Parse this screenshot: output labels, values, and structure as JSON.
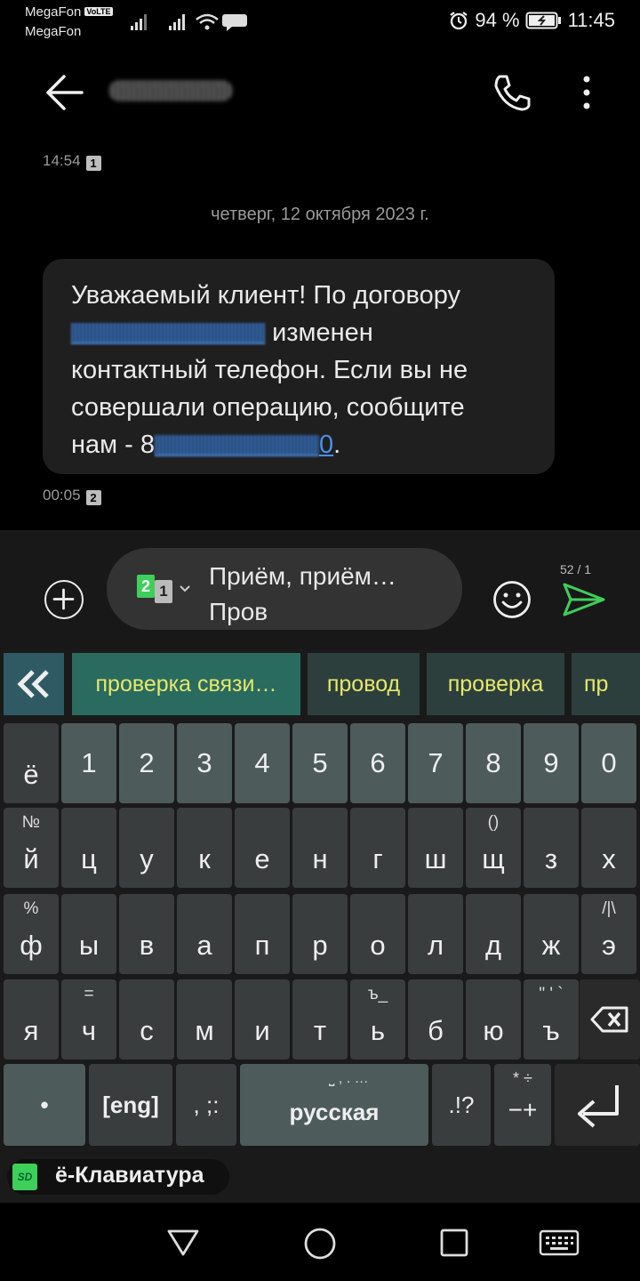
{
  "status_bar": {
    "carrier1": "MegaFon",
    "volte": "VoLTE",
    "carrier2": "MegaFon",
    "battery": "94 %",
    "time": "11:45"
  },
  "header": {
    "contact": ""
  },
  "thread": {
    "prev_time": "14:54",
    "prev_sim": "1",
    "date_divider": "четверг, 12 октября 2023 г.",
    "message": {
      "line1": "Уважаемый клиент! По договору",
      "line2_suffix": "изменен",
      "line3": "контактный телефон. Если вы не",
      "line4": "совершали операцию, сообщите",
      "line5_prefix": "нам - 8",
      "line5_link_end": "0",
      "line5_end": "."
    },
    "time": "00:05",
    "sim": "2"
  },
  "compose": {
    "sim_main": "2",
    "sim_sub": "1",
    "text_line1": "Приём, приём…",
    "text_line2": "Пров",
    "counter": "52 / 1"
  },
  "keyboard": {
    "suggestions": [
      "проверка связи…",
      "провод",
      "проверка",
      "пр"
    ],
    "number_row": [
      "ё",
      "1",
      "2",
      "3",
      "4",
      "5",
      "6",
      "7",
      "8",
      "9",
      "0"
    ],
    "row1": [
      {
        "main": "й",
        "sup": "№"
      },
      {
        "main": "ц",
        "sup": ""
      },
      {
        "main": "у",
        "sup": ""
      },
      {
        "main": "к",
        "sup": ""
      },
      {
        "main": "е",
        "sup": ""
      },
      {
        "main": "н",
        "sup": ""
      },
      {
        "main": "г",
        "sup": ""
      },
      {
        "main": "ш",
        "sup": ""
      },
      {
        "main": "щ",
        "sup": "()"
      },
      {
        "main": "з",
        "sup": ""
      },
      {
        "main": "х",
        "sup": ""
      }
    ],
    "row2": [
      {
        "main": "ф",
        "sup": "%"
      },
      {
        "main": "ы",
        "sup": ""
      },
      {
        "main": "в",
        "sup": ""
      },
      {
        "main": "а",
        "sup": ""
      },
      {
        "main": "п",
        "sup": ""
      },
      {
        "main": "р",
        "sup": ""
      },
      {
        "main": "о",
        "sup": ""
      },
      {
        "main": "л",
        "sup": ""
      },
      {
        "main": "д",
        "sup": ""
      },
      {
        "main": "ж",
        "sup": ""
      },
      {
        "main": "э",
        "sup": "/|\\"
      }
    ],
    "row3": [
      {
        "main": "я",
        "sup": ""
      },
      {
        "main": "ч",
        "sup": "="
      },
      {
        "main": "с",
        "sup": ""
      },
      {
        "main": "м",
        "sup": ""
      },
      {
        "main": "и",
        "sup": ""
      },
      {
        "main": "т",
        "sup": ""
      },
      {
        "main": "ь",
        "sup": "ъ_"
      },
      {
        "main": "б",
        "sup": ""
      },
      {
        "main": "ю",
        "sup": ""
      },
      {
        "main": "ъ",
        "sup": "\" ' `"
      }
    ],
    "bottom": {
      "dot": "•",
      "eng": "[eng]",
      "punct": ", ;:",
      "space": "русская",
      "space_sup": "⎵ , . …",
      "excl": ".!?",
      "math": "−+",
      "math_sup": "* ÷"
    },
    "brand_logo": "SD",
    "brand": "ё-Клавиатура"
  },
  "colors": {
    "suggestion_text": "#e6e86a",
    "send_green": "#3ecf5a",
    "link_blue": "#4a8fe8"
  }
}
